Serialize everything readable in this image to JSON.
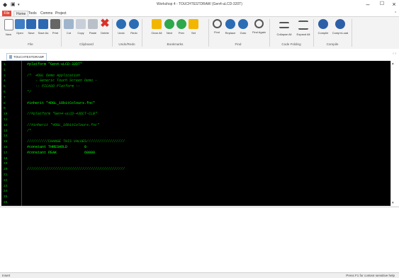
{
  "window": {
    "title": "Workshop 4 - TOUCHTESTDRAW (Gen4-uLCD-320T)"
  },
  "quick_access": {
    "app_icon": "diamond-icon",
    "save_icon": "save-icon"
  },
  "menubar": {
    "items": [
      "File",
      "Home",
      "Tools",
      "Comms",
      "Project"
    ]
  },
  "ribbon": {
    "groups": [
      {
        "label": "File",
        "buttons": [
          "New",
          "Open",
          "Save",
          "Save As",
          "Print"
        ]
      },
      {
        "label": "Clipboard",
        "buttons": [
          "Cut",
          "Copy",
          "Paste",
          "Delete"
        ]
      },
      {
        "label": "Undo/Redo",
        "buttons": [
          "Undo",
          "Redo"
        ]
      },
      {
        "label": "Bookmarks",
        "buttons": [
          "Clear All",
          "Next",
          "Prev",
          "Set"
        ]
      },
      {
        "label": "Find",
        "buttons": [
          "Find",
          "Replace",
          "Goto",
          "Find Again"
        ]
      },
      {
        "label": "Code Folding",
        "buttons": [
          "Collapse All",
          "Expand All"
        ]
      },
      {
        "label": "Compile",
        "buttons": [
          "Compile",
          "Comp'nLoad"
        ]
      }
    ]
  },
  "file_tab": {
    "name": "TOUCHTESTDRAW*",
    "close": "×"
  },
  "editor": {
    "line_numbers": [
      "1",
      "2",
      "3",
      "4",
      "5",
      "6",
      "7",
      "8",
      "9",
      "10",
      "11",
      "12",
      "13",
      "14",
      "15",
      "16",
      "17",
      "18",
      "19",
      "20",
      "21",
      "22",
      "23",
      "24",
      "25",
      "26"
    ],
    "lines": [
      {
        "text": "#platform \"Gen4-uLCD-32DT\"",
        "kind": "str"
      },
      {
        "text": "",
        "kind": "str"
      },
      {
        "text": "/*  4DGL Demo Application",
        "kind": "cmt"
      },
      {
        "text": "    - Generic Touch Screen Demo -",
        "kind": "cmt"
      },
      {
        "text": "    -- PICASO Platform --",
        "kind": "cmt"
      },
      {
        "text": "*/",
        "kind": "cmt"
      },
      {
        "text": "",
        "kind": "str"
      },
      {
        "text": "#inherit \"4DGL_16bitColours.fnc\"",
        "kind": "str"
      },
      {
        "text": "",
        "kind": "str"
      },
      {
        "text": "//#platform \"Gen4-uLCD-43DCT-CLB\"",
        "kind": "cmt"
      },
      {
        "text": "",
        "kind": "str"
      },
      {
        "text": "//#inherit \"4DGL_16bitColours.fnc\"",
        "kind": "cmt"
      },
      {
        "text": "/*",
        "kind": "cmt"
      },
      {
        "text": "",
        "kind": "str"
      },
      {
        "text": "//////////CHANGE THIS VALUES//////////////////",
        "kind": "cmt"
      },
      {
        "text": "#constant THRESHOLD        0",
        "kind": "str"
      },
      {
        "text": "#constant PEAK             60000",
        "kind": "str"
      },
      {
        "text": "",
        "kind": "str"
      },
      {
        "text": "",
        "kind": "str"
      },
      {
        "text": "//////////////////////////////////////////////",
        "kind": "cmt"
      }
    ]
  },
  "status": {
    "left": "Insert",
    "right": "Press F1 for context sensitive help"
  },
  "colors": {
    "file_menu": "#e64a3a",
    "editor_bg": "#000000",
    "code_green": "#00d700"
  }
}
